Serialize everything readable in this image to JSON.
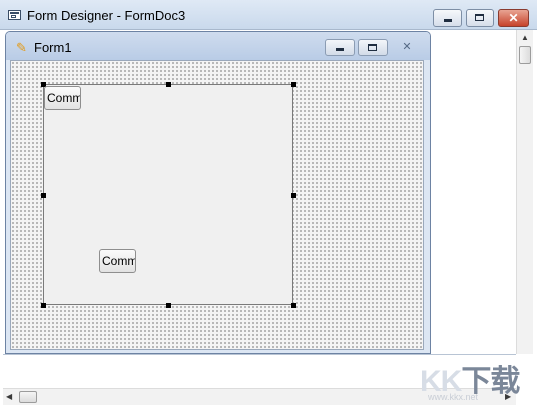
{
  "window": {
    "title": "Form Designer - FormDoc3",
    "icon": "designer-window-icon",
    "controls": {
      "minimize": "minimize-icon",
      "maximize": "maximize-icon",
      "close_glyph": "✕"
    }
  },
  "form": {
    "title": "Form1",
    "icon": "form-icon",
    "icon_glyph": "✎",
    "controls": {
      "minimize": "minimize-icon",
      "maximize": "maximize-icon",
      "close_glyph": "✕"
    }
  },
  "designer": {
    "buttons": [
      {
        "label": "Comm"
      },
      {
        "label": "Comm"
      }
    ]
  },
  "scrollbars": {
    "up_glyph": "▲",
    "down_glyph": "▼",
    "left_glyph": "◀",
    "right_glyph": "▶"
  },
  "watermark": {
    "logo_text": "KK",
    "logo_accent": "下载",
    "url": "www.kkx.net"
  },
  "colors": {
    "title_bar": "#c9d9ec",
    "close_button": "#c7432b",
    "form_icon": "#e39a17",
    "grid_dot": "#2a2a2a"
  }
}
